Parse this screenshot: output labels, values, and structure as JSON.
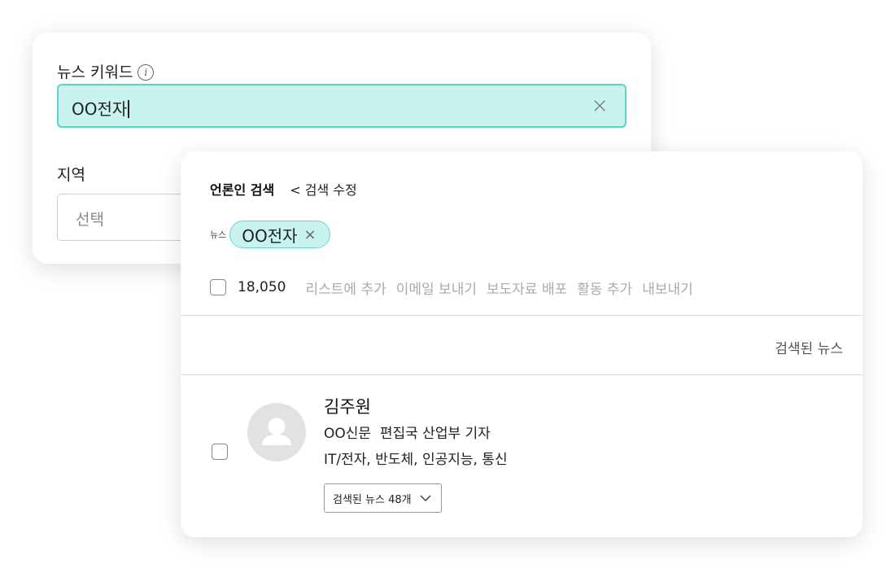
{
  "search_form": {
    "keyword_label": "뉴스 키워드",
    "info_icon": "i",
    "keyword_value": "OO전자",
    "clear_symbol": "×",
    "region_label": "지역",
    "region_value": "선택"
  },
  "results": {
    "title": "언론인 검색",
    "edit_link": "< 검색 수정",
    "filter": {
      "type_label": "뉴스",
      "chip_value": "OO전자",
      "chip_remove": "×"
    },
    "total_count": "18,050",
    "actions": [
      "리스트에 추가",
      "이메일 보내기",
      "보도자료 배포",
      "활동 추가",
      "내보내기"
    ],
    "column_header": "검색된 뉴스",
    "journalist": {
      "name": "김주원",
      "organization": "OO신문  편집국 산업부 기자",
      "topics": "IT/전자, 반도체, 인공지능, 통신",
      "news_dropdown": "검색된 뉴스 48개"
    }
  },
  "colors": {
    "accent_fill": "#c8f3ef",
    "accent_border": "#5cd3c4",
    "muted_text": "#aaaaaa"
  }
}
